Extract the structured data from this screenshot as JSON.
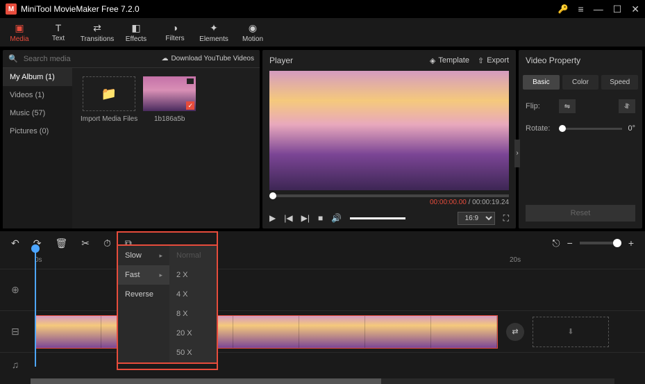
{
  "titlebar": {
    "title": "MiniTool MovieMaker Free 7.2.0"
  },
  "toolbar": [
    {
      "label": "Media",
      "active": true
    },
    {
      "label": "Text"
    },
    {
      "label": "Transitions"
    },
    {
      "label": "Effects"
    },
    {
      "label": "Filters"
    },
    {
      "label": "Elements"
    },
    {
      "label": "Motion"
    }
  ],
  "media": {
    "search_placeholder": "Search media",
    "download_label": "Download YouTube Videos",
    "sidebar": [
      {
        "label": "My Album (1)",
        "active": true
      },
      {
        "label": "Videos (1)"
      },
      {
        "label": "Music (57)"
      },
      {
        "label": "Pictures (0)"
      }
    ],
    "import_label": "Import Media Files",
    "clip_label": "1b186a5b"
  },
  "player": {
    "title": "Player",
    "template_label": "Template",
    "export_label": "Export",
    "time_current": "00:00:00.00",
    "time_total": "00:00:19.24",
    "ratio": "16:9"
  },
  "property": {
    "title": "Video Property",
    "tabs": [
      {
        "label": "Basic",
        "active": true
      },
      {
        "label": "Color"
      },
      {
        "label": "Speed"
      }
    ],
    "flip_label": "Flip:",
    "rotate_label": "Rotate:",
    "rotate_value": "0°",
    "reset_label": "Reset"
  },
  "timeline": {
    "ruler": {
      "zero": "0s",
      "twenty": "20s"
    }
  },
  "speed_menu": {
    "items": [
      {
        "label": "Slow",
        "arrow": true
      },
      {
        "label": "Fast",
        "arrow": true,
        "sel": true
      },
      {
        "label": "Reverse"
      }
    ],
    "sub": [
      {
        "label": "Normal",
        "disabled": true
      },
      {
        "label": "2 X"
      },
      {
        "label": "4 X"
      },
      {
        "label": "8 X"
      },
      {
        "label": "20 X"
      },
      {
        "label": "50 X"
      }
    ]
  }
}
